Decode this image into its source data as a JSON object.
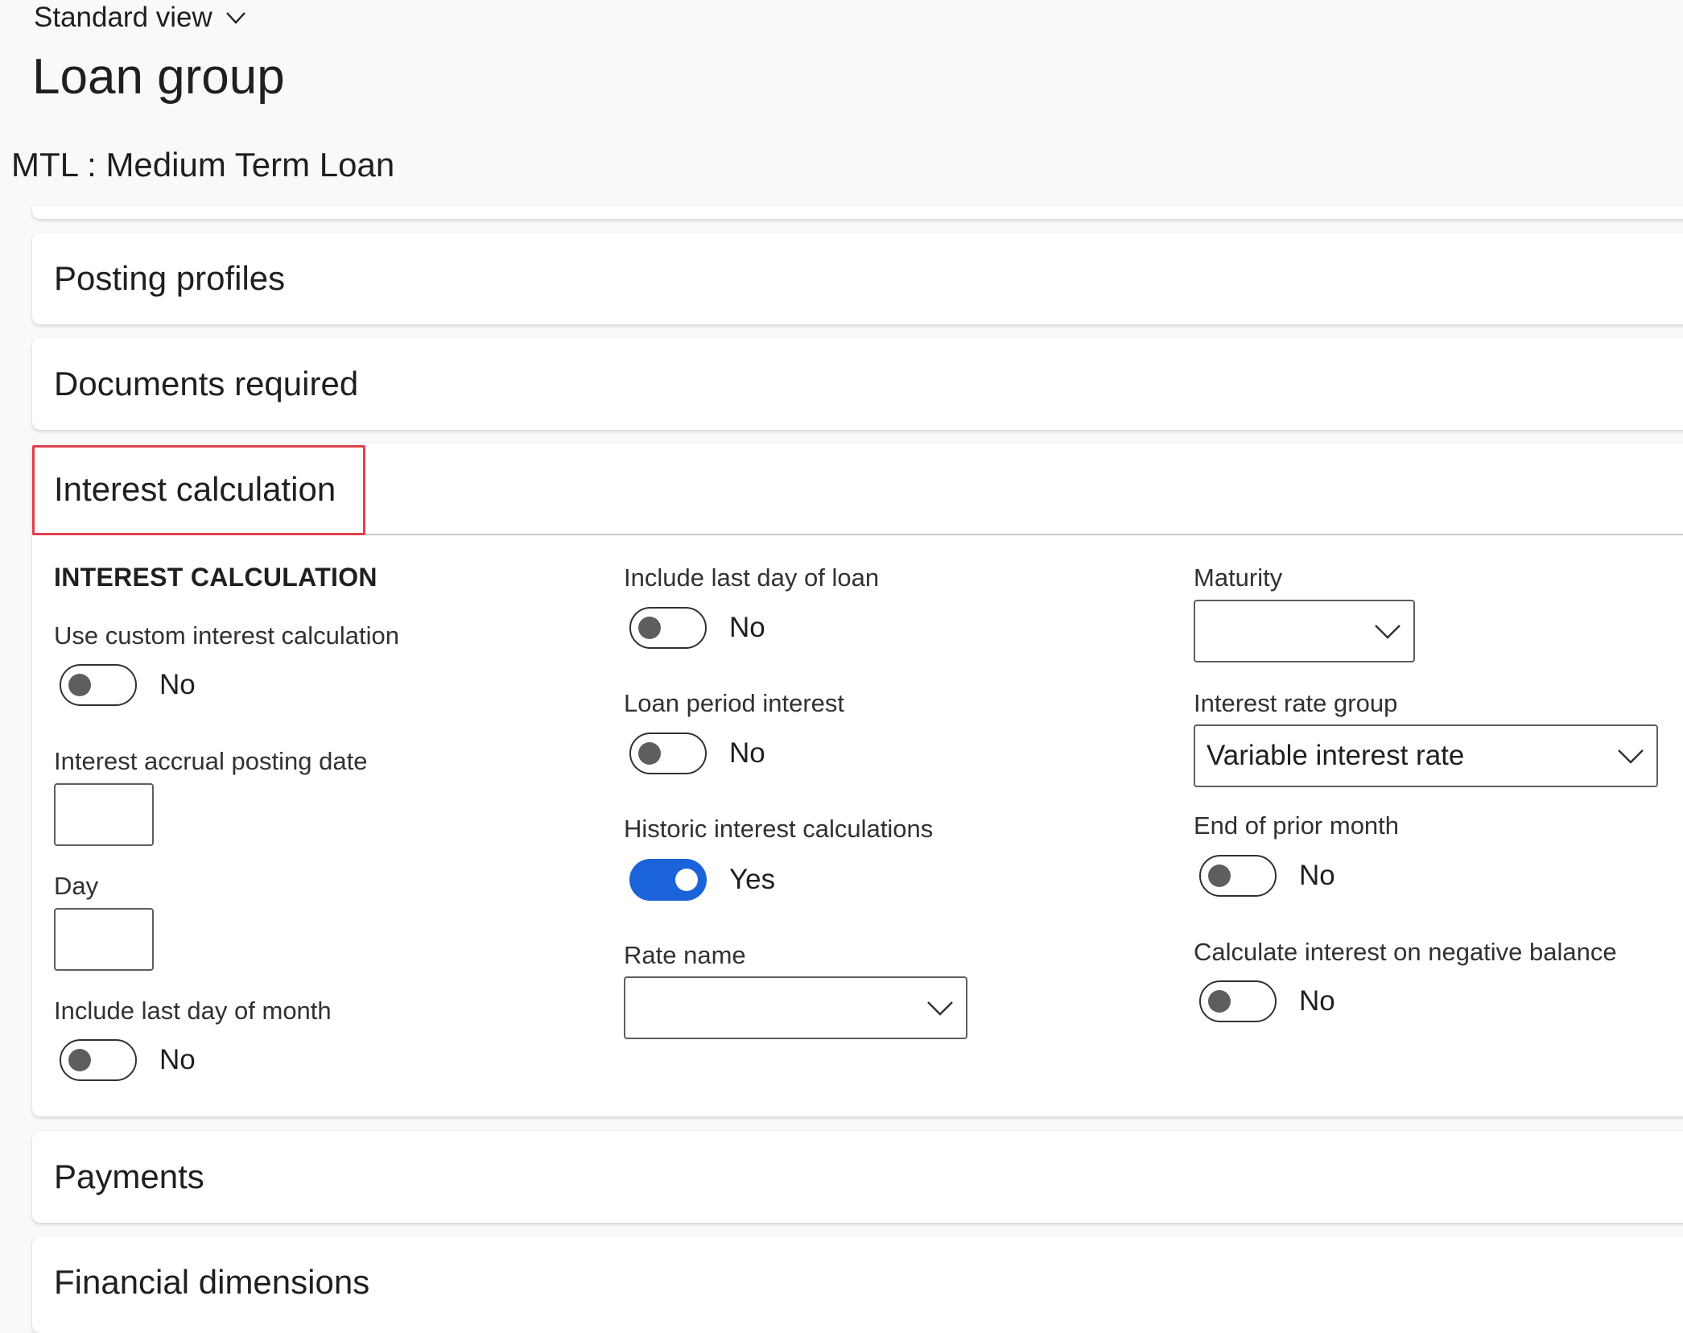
{
  "header": {
    "view_label": "Standard view",
    "page_title": "Loan group",
    "record_title": "MTL : Medium Term Loan"
  },
  "fasttabs": {
    "posting_profiles": "Posting profiles",
    "documents_required": "Documents required",
    "interest_calculation": "Interest calculation",
    "payments": "Payments",
    "financial_dimensions": "Financial dimensions"
  },
  "interest": {
    "group_title": "INTEREST CALCULATION",
    "use_custom": {
      "label": "Use custom interest calculation",
      "value": "No"
    },
    "accrual_posting_date": {
      "label": "Interest accrual posting date",
      "value": ""
    },
    "day": {
      "label": "Day",
      "value": ""
    },
    "include_last_day_month": {
      "label": "Include last day of month",
      "value": "No"
    },
    "include_last_day_loan": {
      "label": "Include last day of loan",
      "value": "No"
    },
    "loan_period_interest": {
      "label": "Loan period interest",
      "value": "No"
    },
    "historic_calculations": {
      "label": "Historic interest calculations",
      "value": "Yes"
    },
    "rate_name": {
      "label": "Rate name",
      "value": ""
    },
    "maturity": {
      "label": "Maturity",
      "value": ""
    },
    "interest_rate_group": {
      "label": "Interest rate group",
      "value": "Variable interest rate"
    },
    "end_of_prior_month": {
      "label": "End of prior month",
      "value": "No"
    },
    "negative_balance": {
      "label": "Calculate interest on negative balance",
      "value": "No"
    }
  },
  "colors": {
    "toggle_on": "#1b63d8",
    "highlight": "#e0404f",
    "background": "#faf9f8"
  },
  "icons": {
    "view_chevron": "chevron-down-icon",
    "dropdown_chevron": "chevron-down-icon"
  }
}
